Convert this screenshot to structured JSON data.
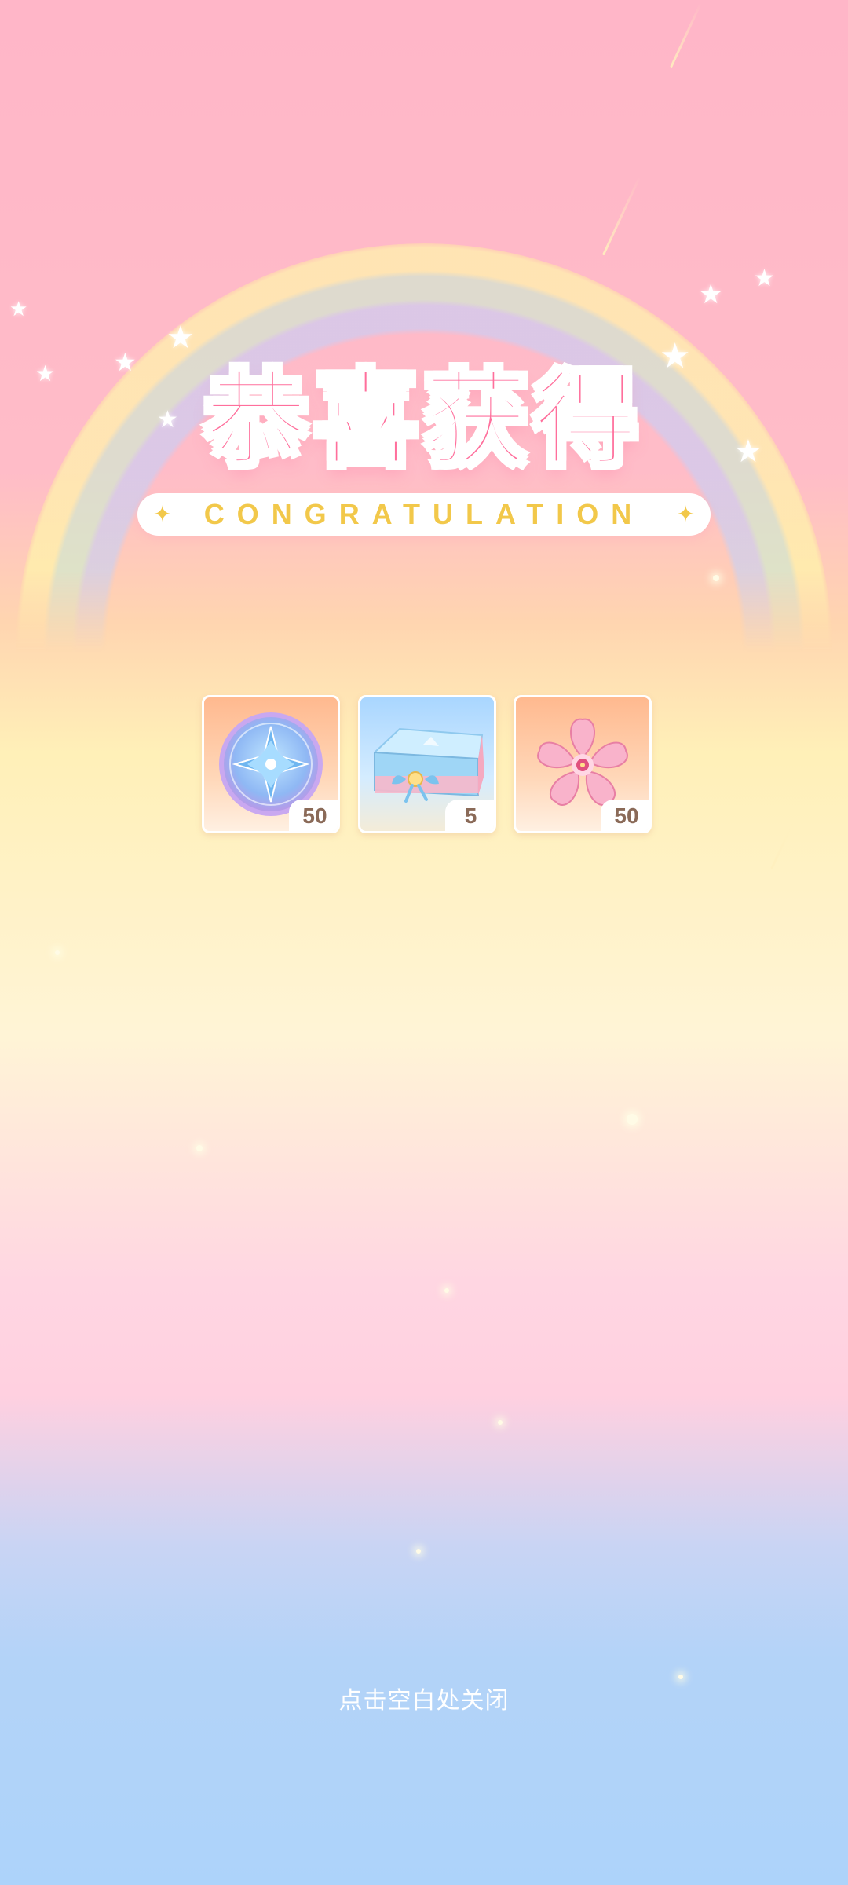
{
  "header": {
    "title": "恭喜获得",
    "subtitle": "CONGRATULATION"
  },
  "rewards": [
    {
      "icon": "star-coin-icon",
      "quantity": "50"
    },
    {
      "icon": "gift-box-icon",
      "quantity": "5"
    },
    {
      "icon": "cherry-blossom-icon",
      "quantity": "50"
    }
  ],
  "footer": {
    "close_hint": "点击空白处关闭"
  },
  "colors": {
    "title": "#ff6f9c",
    "subtitle": "#f2c84a",
    "quantity_text": "#8a6a58"
  }
}
